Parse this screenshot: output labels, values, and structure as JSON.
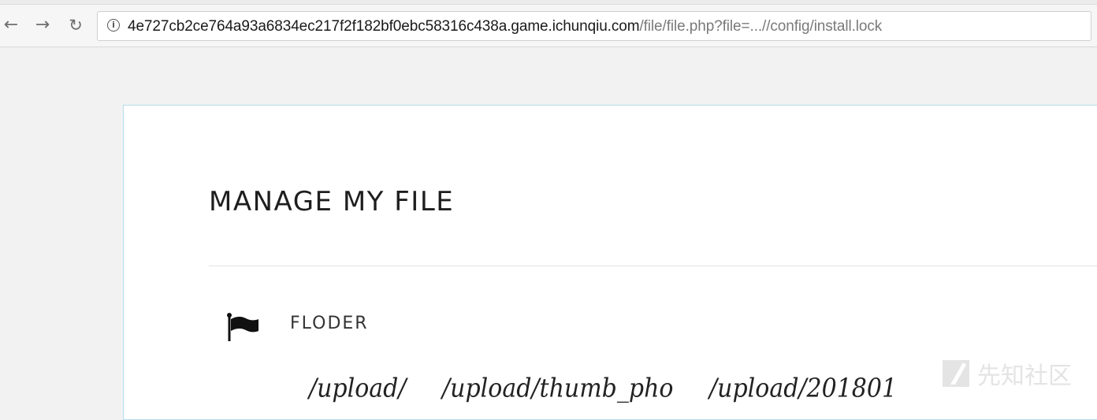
{
  "browser": {
    "nav": {
      "back_glyph": "←",
      "forward_glyph": "→",
      "reload_glyph": "↻"
    },
    "address_bar": {
      "info_glyph": "i",
      "host": "4e727cb2ce764a93a6834ec217f2f182bf0ebc58316c438a.game.ichunqiu.com",
      "path": "/file/file.php?file=...//config/install.lock"
    }
  },
  "page": {
    "title": "MANAGE MY FILE",
    "folder_label": "FLODER",
    "folder_icon": "flag-icon",
    "folders": [
      "/upload/",
      "/upload/thumb_pho",
      "/upload/201801"
    ]
  },
  "watermark": {
    "text": "先知社区"
  },
  "colors": {
    "card_border": "#b6dcea",
    "page_background": "#f2f2f2",
    "url_host": "#1a1a1a",
    "url_path": "#7a7a7a"
  }
}
